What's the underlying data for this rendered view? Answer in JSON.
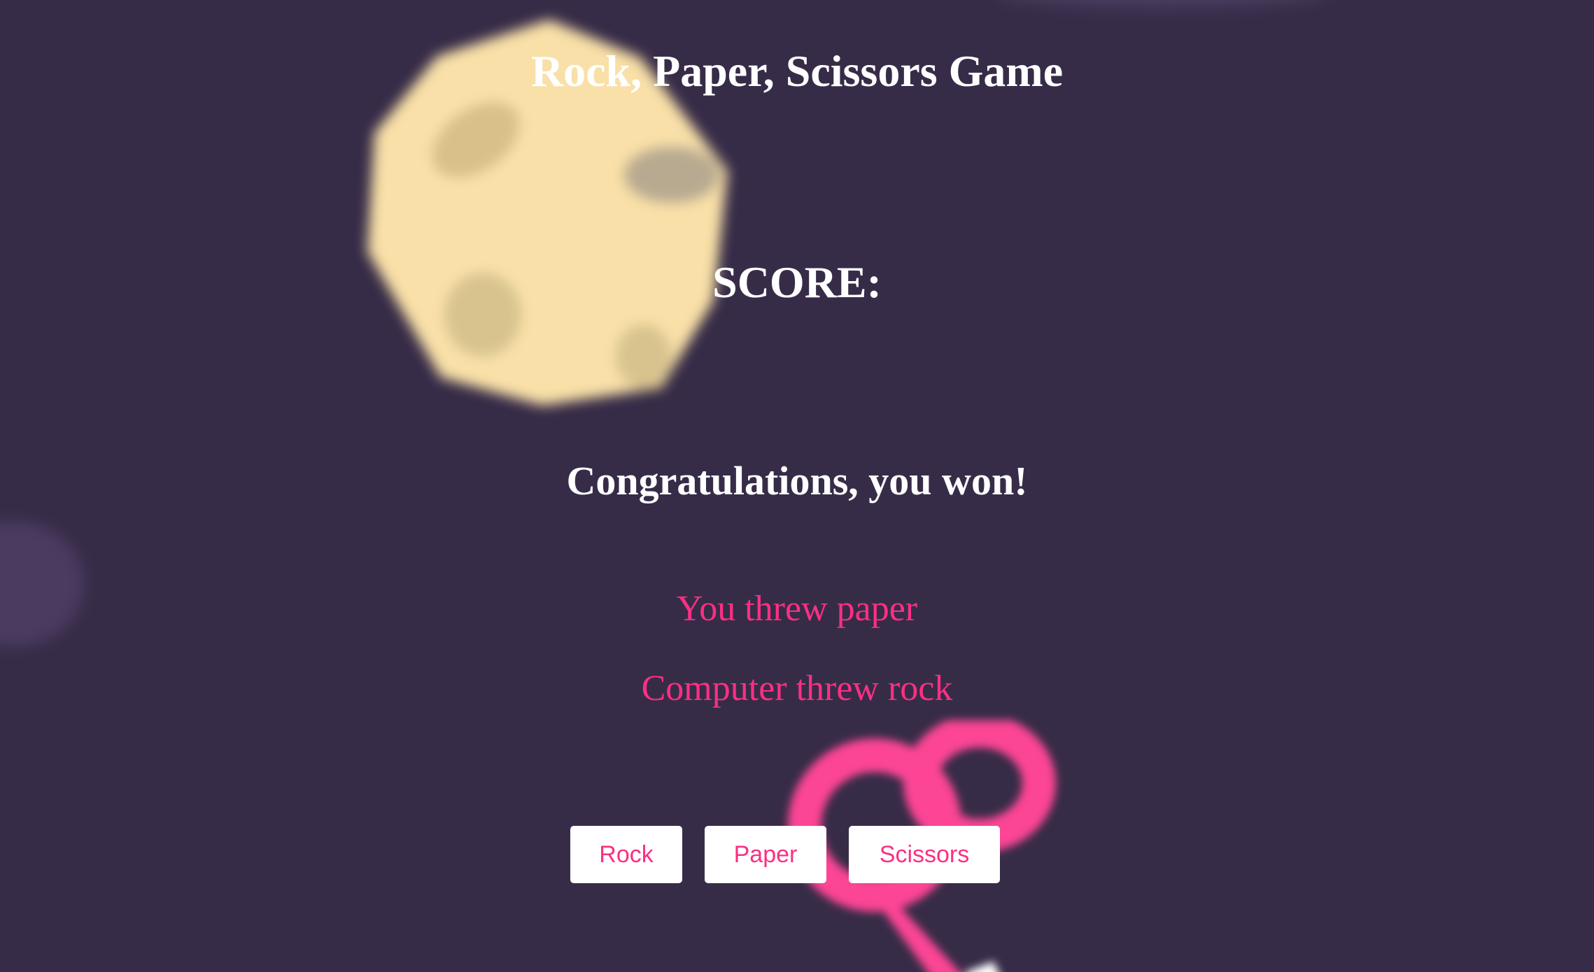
{
  "game": {
    "title": "Rock, Paper, Scissors Game",
    "score_label": "SCORE:",
    "result_message": "Congratulations, you won!",
    "player_throw": "You threw paper",
    "computer_throw": "Computer threw rock"
  },
  "choices": {
    "rock_label": "Rock",
    "paper_label": "Paper",
    "scissors_label": "Scissors"
  },
  "background_art": {
    "rock_icon": "blurred-rock-illustration",
    "scissors_icon": "blurred-scissors-illustration"
  },
  "colors": {
    "background": "#372c48",
    "heading_text": "#ffffff",
    "accent_pink": "#fc2f83",
    "rock_art": "#f9e0a8",
    "button_bg": "#ffffff"
  }
}
